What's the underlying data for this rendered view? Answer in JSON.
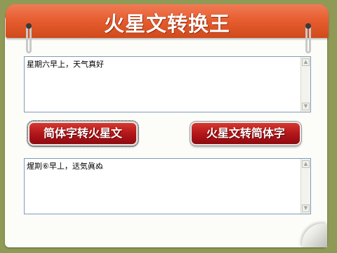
{
  "header": {
    "title": "火星文转换王"
  },
  "input": {
    "text": "星期六早上，天气真好"
  },
  "buttons": {
    "to_martian": "简体字转火星文",
    "to_simplified": "火星文转简体字"
  },
  "output": {
    "text": "煋剘⑥早丄，迗気眞ぬ"
  },
  "icons": {
    "scroll_up": "scroll-up-arrow",
    "scroll_down": "scroll-down-arrow"
  },
  "colors": {
    "header": "#e65c2e",
    "button": "#b3161a",
    "background": "#8f9a57"
  }
}
